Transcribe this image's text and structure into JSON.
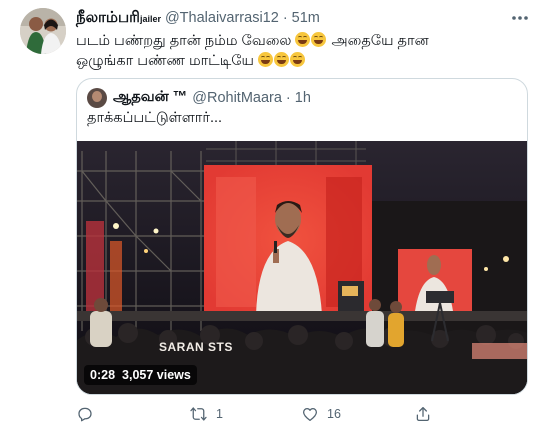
{
  "tweet": {
    "display_name": "நீலாம்பரி",
    "name_suffix": "jailer",
    "handle": "@Thalaivarrasi12",
    "separator": "·",
    "time": "51m",
    "text_line1": "படம் பண்றது தான் நம்ம வேலை",
    "text_line1_after": "அதையே தான",
    "text_line2": "ஒழுங்கா பண்ண மாட்டியே"
  },
  "quoted_tweet": {
    "display_name": "ஆதவன் ™",
    "handle": "@RohitMaara",
    "separator": "·",
    "time": "1h",
    "text": "தாக்கப்பட்டுள்ளார்...",
    "video": {
      "watermark": "SARAN STS",
      "duration": "0:28",
      "views": "3,057 views"
    }
  },
  "actions": {
    "reply_count": "",
    "retweet_count": "1",
    "like_count": "16"
  },
  "icons": {
    "more": "more-horizontal-icon",
    "reply": "reply-icon",
    "retweet": "retweet-icon",
    "like": "heart-icon",
    "share": "share-icon",
    "emoji": "face-with-tears-of-joy-emoji"
  },
  "colors": {
    "text": "#0f1419",
    "secondary": "#536471",
    "border": "#cfd9de"
  }
}
